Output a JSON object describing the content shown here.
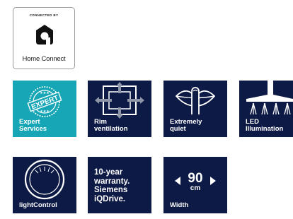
{
  "badge": {
    "connected_by": "CONNECTED BY",
    "name": "Home Connect"
  },
  "tiles": {
    "expert": {
      "stamp": "EXPERT",
      "caption_line1": "Expert",
      "caption_line2": "Services"
    },
    "rim": {
      "caption_line1": "Rim",
      "caption_line2": "ventilation"
    },
    "quiet": {
      "caption_line1": "Extremely",
      "caption_line2": "quiet"
    },
    "led": {
      "caption_line1": "LED",
      "caption_line2": "Illumination"
    },
    "light": {
      "caption": "lightControl"
    },
    "warranty": {
      "line1": "10-year",
      "line2": "warranty.",
      "line3": "Siemens",
      "line4": "iQDrive."
    },
    "width": {
      "value": "90",
      "unit": "cm",
      "caption": "Width"
    }
  },
  "colors": {
    "navy": "#0d1a45",
    "teal": "#16a6b6",
    "white": "#ffffff"
  }
}
